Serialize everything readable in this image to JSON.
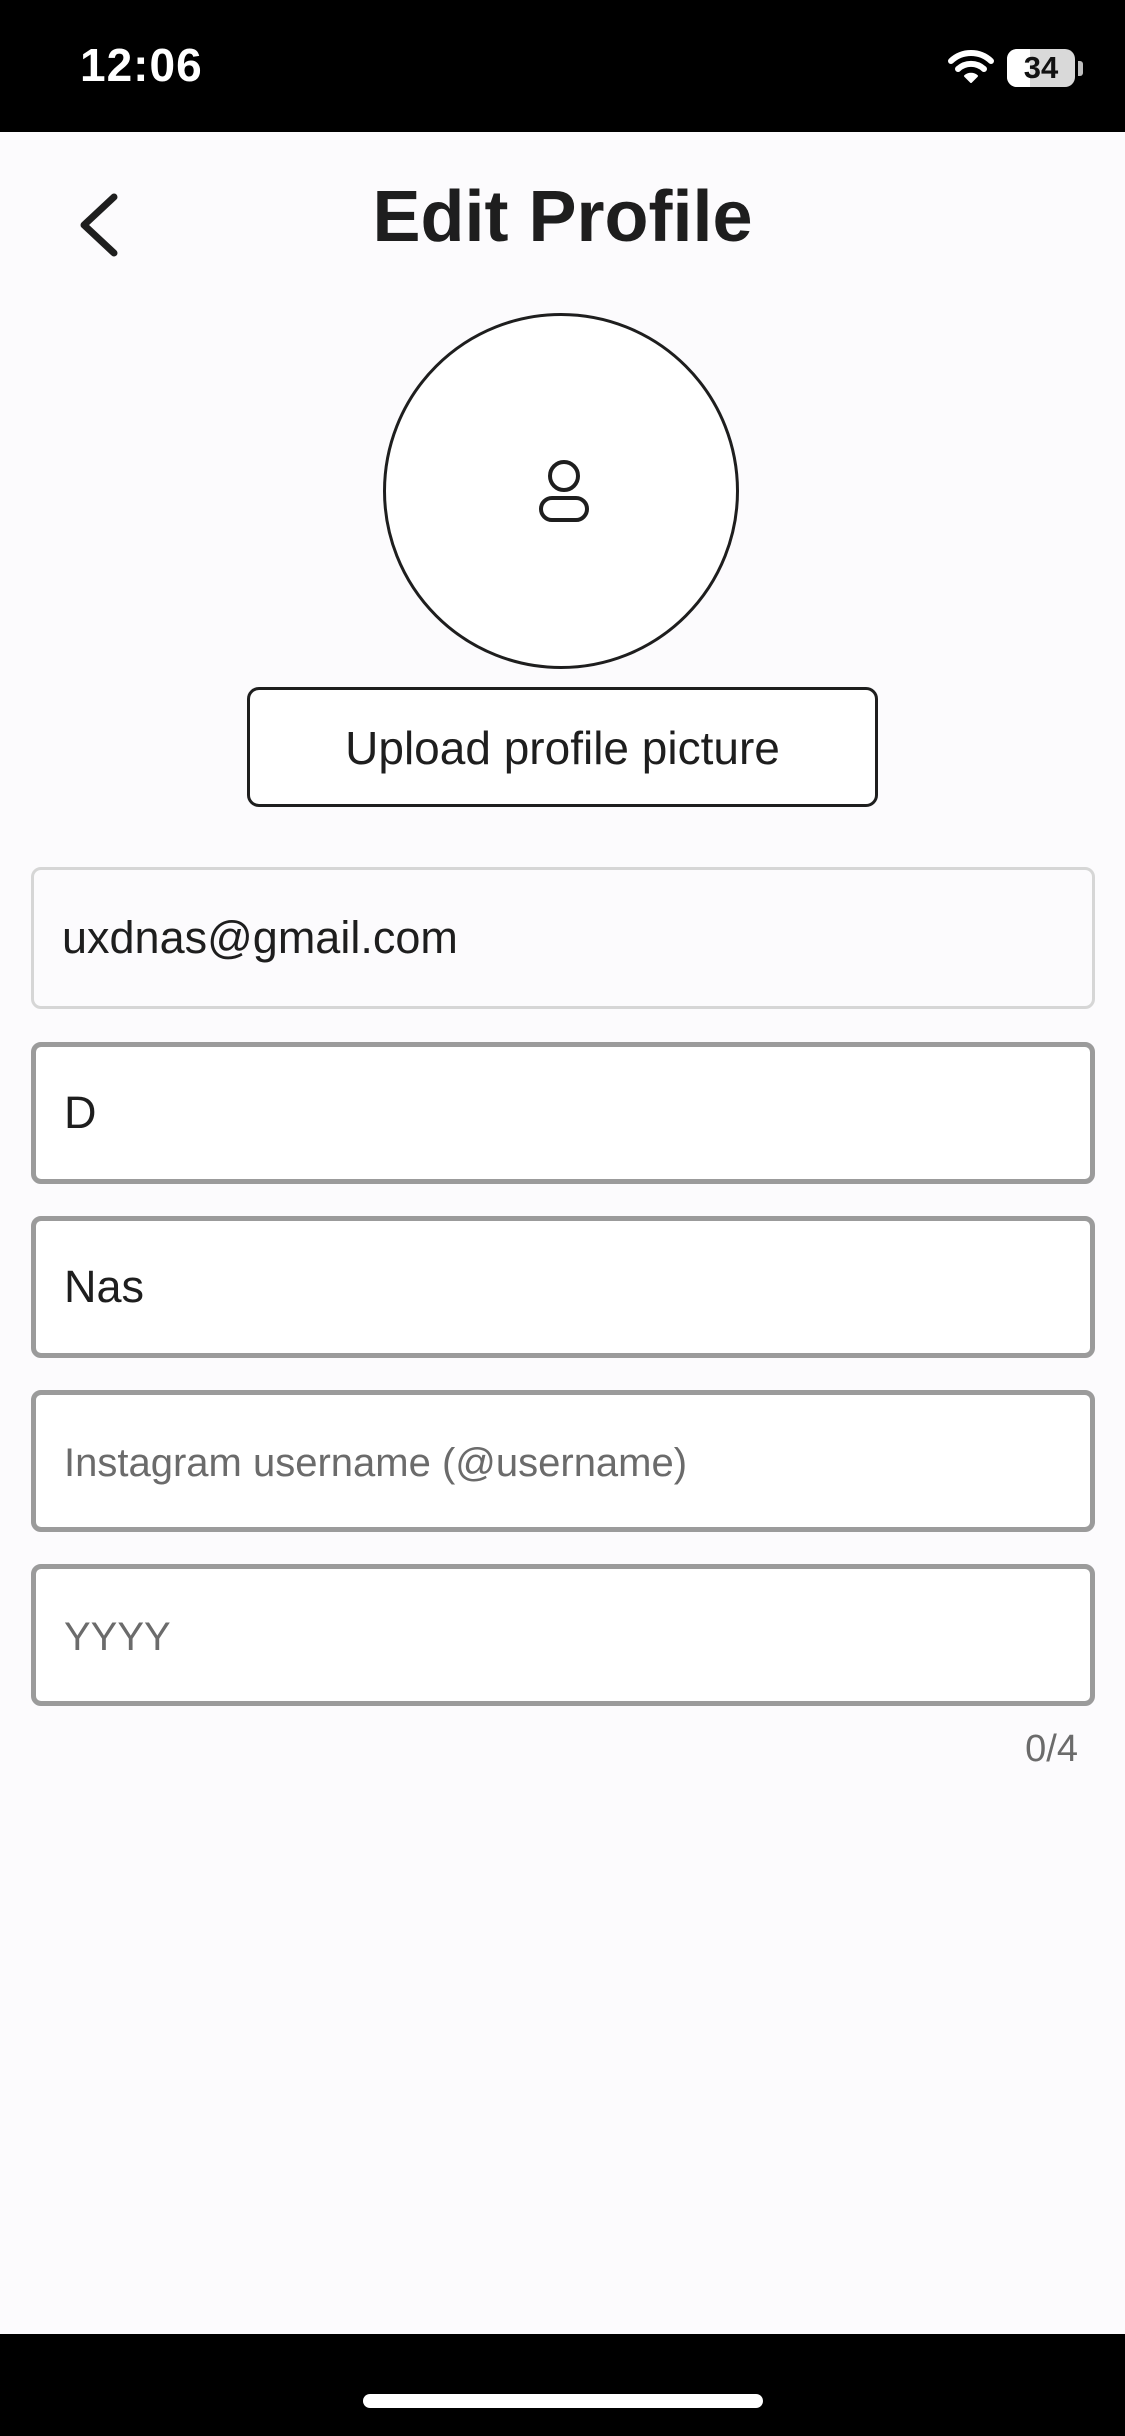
{
  "status_bar": {
    "time": "12:06",
    "battery_percent": 34,
    "battery_label": "34"
  },
  "header": {
    "title": "Edit Profile"
  },
  "profile": {
    "upload_label": "Upload profile picture"
  },
  "form": {
    "email": {
      "value": "uxdnas@gmail.com",
      "disabled": true
    },
    "first_name": {
      "value": "D"
    },
    "last_name": {
      "value": "Nas"
    },
    "instagram": {
      "value": "",
      "placeholder": "Instagram username (@username)"
    },
    "birth_year": {
      "value": "",
      "placeholder": "YYYY",
      "counter": "0/4"
    }
  }
}
